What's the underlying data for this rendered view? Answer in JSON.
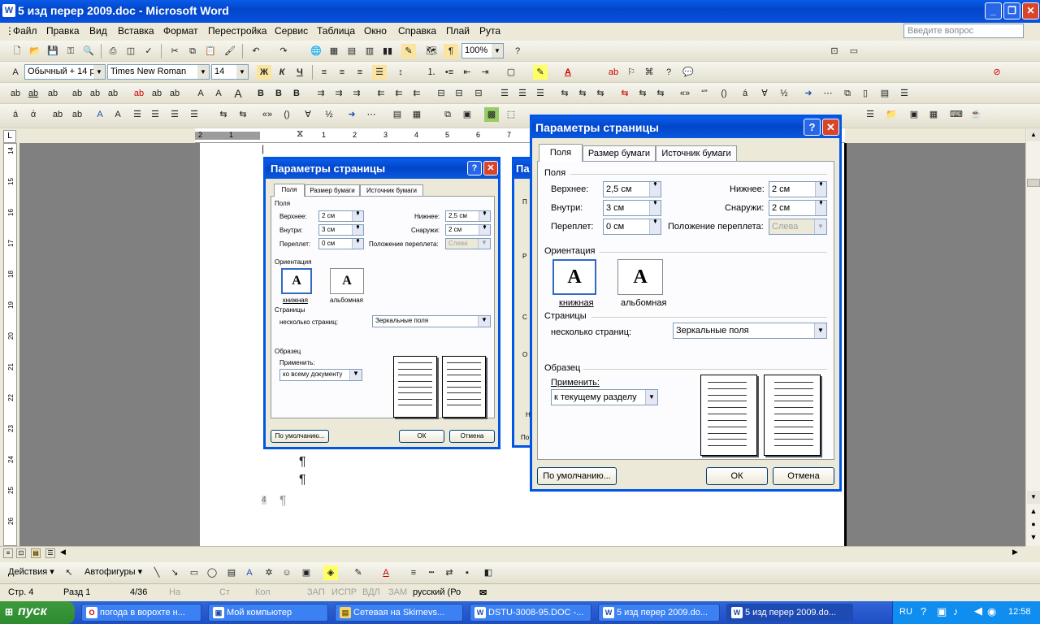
{
  "window": {
    "title": "5 изд перер 2009.doc - Microsoft Word",
    "app_icon": "W"
  },
  "menu": {
    "items": [
      "Файл",
      "Правка",
      "Вид",
      "Вставка",
      "Формат",
      "Перестройка",
      "Сервис",
      "Таблица",
      "Окно",
      "Справка",
      "Плай",
      "Рута"
    ],
    "ask_placeholder": "Введите вопрос"
  },
  "toolbar_std": {
    "zoom": "100%"
  },
  "toolbar_fmt": {
    "style": "Обычный + 14 р",
    "font": "Times New Roman",
    "size": "14"
  },
  "ruler": {
    "h_labels": [
      "2",
      "1",
      "1",
      "2",
      "3",
      "4",
      "5",
      "6",
      "7",
      "8"
    ],
    "v_labels": [
      "14",
      "15",
      "16",
      "17",
      "18",
      "19",
      "20",
      "21",
      "22",
      "23",
      "24",
      "25",
      "26"
    ]
  },
  "dialog_small": {
    "title": "Параметры страницы",
    "tabs": [
      "Поля",
      "Размер бумаги",
      "Источник бумаги"
    ],
    "section_margins": "Поля",
    "top_label": "Верхнее:",
    "top_value": "2 см",
    "bottom_label": "Нижнее:",
    "bottom_value": "2,5 см",
    "inside_label": "Внутри:",
    "inside_value": "3 см",
    "outside_label": "Снаружи:",
    "outside_value": "2 см",
    "gutter_label": "Переплет:",
    "gutter_value": "0 см",
    "gutter_pos_label": "Положение переплета:",
    "gutter_pos_value": "Слева",
    "section_orientation": "Ориентация",
    "portrait": "книжная",
    "landscape": "альбомная",
    "section_pages": "Страницы",
    "multiple_label": "несколько страниц:",
    "multiple_value": "Зеркальные поля",
    "section_preview": "Образец",
    "apply_label": "Применить:",
    "apply_value": "ко всему документу",
    "default_btn": "По умолчанию...",
    "ok_btn": "ОК",
    "cancel_btn": "Отмена"
  },
  "dialog_mid": {
    "title": "Пара",
    "letters": [
      "П",
      "Р",
      "С",
      "О",
      "Н",
      "По"
    ]
  },
  "dialog_main": {
    "title": "Параметры страницы",
    "tabs": [
      "Поля",
      "Размер бумаги",
      "Источник бумаги"
    ],
    "section_margins": "Поля",
    "top_label": "Верхнее:",
    "top_value": "2,5 см",
    "bottom_label": "Нижнее:",
    "bottom_value": "2 см",
    "inside_label": "Внутри:",
    "inside_value": "3 см",
    "outside_label": "Снаружи:",
    "outside_value": "2 см",
    "gutter_label": "Переплет:",
    "gutter_value": "0 см",
    "gutter_pos_label": "Положение переплета:",
    "gutter_pos_value": "Слева",
    "section_orientation": "Ориентация",
    "portrait": "книжная",
    "landscape": "альбомная",
    "section_pages": "Страницы",
    "multiple_label": "несколько страниц:",
    "multiple_value": "Зеркальные поля",
    "section_preview": "Образец",
    "apply_label": "Применить:",
    "apply_value": "к текущему разделу",
    "default_btn": "По умолчанию...",
    "ok_btn": "ОК",
    "cancel_btn": "Отмена"
  },
  "drawbar": {
    "actions": "Действия",
    "autoshapes": "Автофигуры"
  },
  "status": {
    "page": "Стр. 4",
    "section": "Разд 1",
    "pages": "4/36",
    "at": "На",
    "line": "Ст",
    "col": "Кол",
    "rec": "ЗАП",
    "trk": "ИСПР",
    "ext": "ВДЛ",
    "ovr": "ЗАМ",
    "lang": "русский (Ро"
  },
  "taskbar": {
    "start": "пуск",
    "buttons": [
      "погода в ворохте н...",
      "Мой компьютер",
      "Сетевая на Skirnevs...",
      "DSTU-3008-95.DOC -...",
      "5 изд перер 2009.do...",
      "5 изд перер 2009.do..."
    ],
    "lang": "RU",
    "clock": "12:58"
  },
  "doc": {
    "pilcrow": "¶",
    "pagenum": "4"
  }
}
